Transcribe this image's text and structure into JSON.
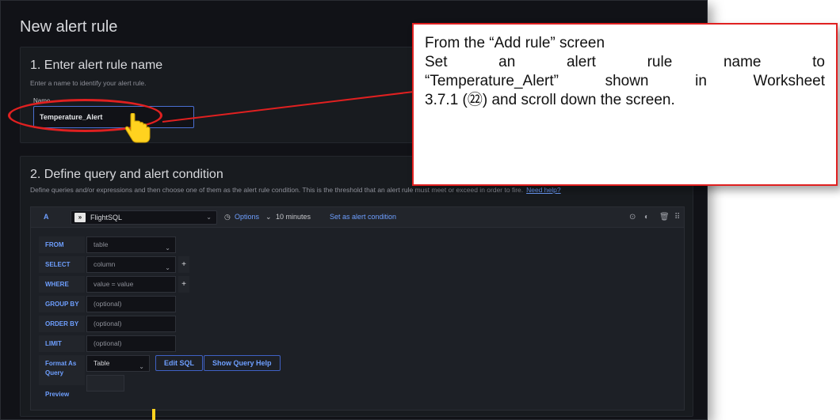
{
  "page_title": "New alert rule",
  "section1": {
    "title": "1. Enter alert rule name",
    "description": "Enter a name to identify your alert rule.",
    "field_label": "Name",
    "name_value": "Temperature_Alert"
  },
  "section2": {
    "title": "2. Define query and alert condition",
    "description": "Define queries and/or expressions and then choose one of them as the alert rule condition. This is the threshold that an alert rule must meet or exceed in order to fire.",
    "help_link": "Need help?",
    "query": {
      "ref_id": "A",
      "datasource": "FlightSQL",
      "datasource_logo": "»",
      "options_label": "Options",
      "time_range": "10 minutes",
      "set_condition": "Set as alert condition",
      "header_icons": [
        "copy-icon",
        "eye-icon",
        "trash-icon",
        "drag-handle-icon"
      ]
    },
    "rows": [
      {
        "label": "FROM",
        "value": "table",
        "has_dropdown": true,
        "has_plus": false
      },
      {
        "label": "SELECT",
        "value": "column",
        "has_dropdown": true,
        "has_plus": true
      },
      {
        "label": "WHERE",
        "value": "value = value",
        "has_dropdown": false,
        "has_plus": true
      },
      {
        "label": "GROUP BY",
        "value": "(optional)",
        "has_dropdown": false,
        "has_plus": false
      },
      {
        "label": "ORDER BY",
        "value": "(optional)",
        "has_dropdown": false,
        "has_plus": false
      },
      {
        "label": "LIMIT",
        "value": "(optional)",
        "has_dropdown": false,
        "has_plus": false
      }
    ],
    "format_as_label": "Format As",
    "query_label": "Query",
    "format_as_value": "Table",
    "edit_sql_button": "Edit SQL",
    "show_help_button": "Show Query Help",
    "preview_label": "Preview"
  },
  "callout": {
    "line1": "From the “Add rule” screen",
    "line2": "Set an alert rule name to",
    "line3": "“Temperature_Alert” shown in Worksheet",
    "line4": "3.7.1 (㉒) and scroll down the screen."
  },
  "colors": {
    "annotation_red": "#e02020",
    "accent_blue": "#6e9fff",
    "background_dark": "#111217"
  }
}
